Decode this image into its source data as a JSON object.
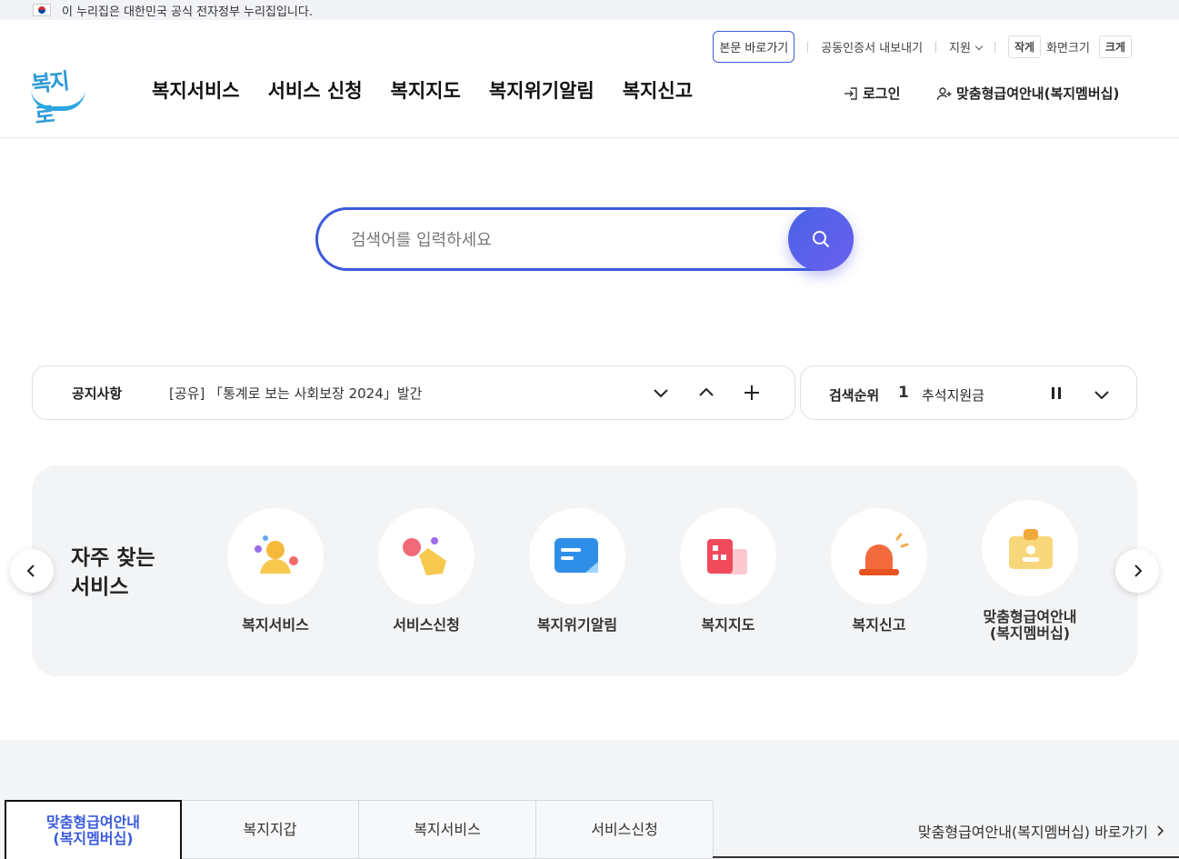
{
  "gov_bar": {
    "text": "이 누리집은 대한민국 공식 전자정부 누리집입니다."
  },
  "util": {
    "skip": "본문 바로가기",
    "cert": "공동인증서 내보내기",
    "support": "지원",
    "small": "작게",
    "screen_size": "화면크기",
    "large": "크게"
  },
  "logo": {
    "text": "복지로"
  },
  "gnb": [
    "복지서비스",
    "서비스 신청",
    "복지지도",
    "복지위기알림",
    "복지신고"
  ],
  "account": {
    "login": "로그인",
    "member": "맞춤형급여안내(복지멤버십)"
  },
  "search": {
    "placeholder": "검색어를 입력하세요"
  },
  "notice": {
    "label": "공지사항",
    "message": "[공유] 「통계로 보는 사회보장 2024」발간"
  },
  "rank": {
    "label": "검색순위",
    "number": "1",
    "keyword": "추석지원금"
  },
  "frequent": {
    "title_line1": "자주 찾는",
    "title_line2": "서비스",
    "items": [
      {
        "label": "복지서비스",
        "icon": "person-welfare-icon"
      },
      {
        "label": "서비스신청",
        "icon": "hand-tap-icon"
      },
      {
        "label": "복지위기알림",
        "icon": "chat-notice-icon"
      },
      {
        "label": "복지지도",
        "icon": "building-map-icon"
      },
      {
        "label": "복지신고",
        "icon": "siren-icon"
      },
      {
        "label": "맞춤형급여안내\n(복지멤버십)",
        "icon": "id-card-icon"
      }
    ]
  },
  "tabs": [
    {
      "label": "맞춤형급여안내\n(복지멤버십)",
      "active": true
    },
    {
      "label": "복지지갑",
      "active": false
    },
    {
      "label": "복지서비스",
      "active": false
    },
    {
      "label": "서비스신청",
      "active": false
    }
  ],
  "goto_link": "맞춤형급여안내(복지멤버십) 바로가기",
  "colors": {
    "primary": "#3b5bdb",
    "logo_blue": "#2aa6e0"
  }
}
